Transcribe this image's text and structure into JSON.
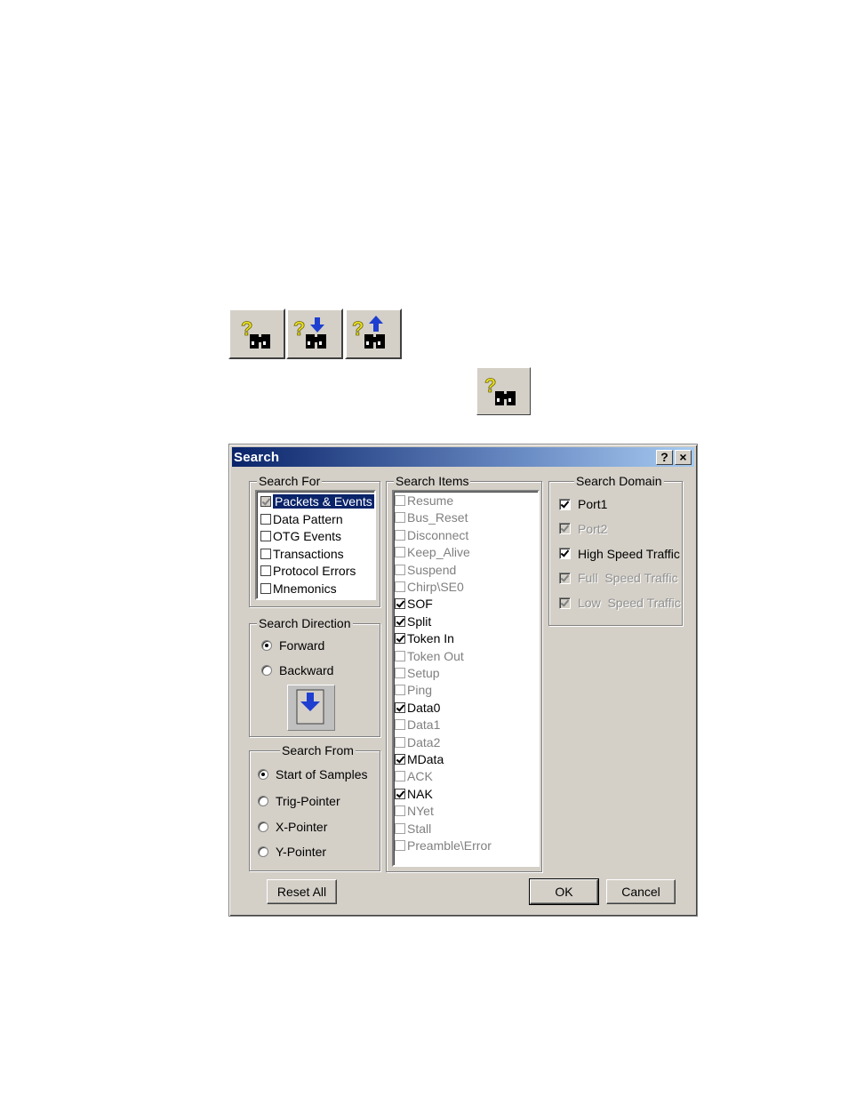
{
  "toolbar": {
    "icons": [
      "search-binoculars-icon",
      "search-next-icon",
      "search-previous-icon"
    ],
    "standalone_icon": "search-binoculars-icon"
  },
  "dialog": {
    "title": "Search",
    "help_label": "?",
    "close_label": "×",
    "search_for": {
      "legend": "Search For",
      "items": [
        {
          "label": "Packets & Events",
          "checked": true,
          "selected": true,
          "disabled": false
        },
        {
          "label": "Data Pattern",
          "checked": false,
          "selected": false,
          "disabled": false
        },
        {
          "label": "OTG Events",
          "checked": false,
          "selected": false,
          "disabled": false
        },
        {
          "label": "Transactions",
          "checked": false,
          "selected": false,
          "disabled": false
        },
        {
          "label": "Protocol Errors",
          "checked": false,
          "selected": false,
          "disabled": false
        },
        {
          "label": "Mnemonics",
          "checked": false,
          "selected": false,
          "disabled": false
        }
      ]
    },
    "search_direction": {
      "legend": "Search Direction",
      "forward": "Forward",
      "backward": "Backward",
      "selected": "forward"
    },
    "search_from": {
      "legend": "Search From",
      "options": [
        "Start of Samples",
        "Trig-Pointer",
        "X-Pointer",
        "Y-Pointer"
      ],
      "selected_index": 0
    },
    "search_items": {
      "legend": "Search Items",
      "items": [
        {
          "label": "Resume",
          "checked": false,
          "disabled": true
        },
        {
          "label": "Bus_Reset",
          "checked": false,
          "disabled": true
        },
        {
          "label": "Disconnect",
          "checked": false,
          "disabled": true
        },
        {
          "label": "Keep_Alive",
          "checked": false,
          "disabled": true
        },
        {
          "label": "Suspend",
          "checked": false,
          "disabled": true
        },
        {
          "label": "Chirp\\SE0",
          "checked": false,
          "disabled": true
        },
        {
          "label": "SOF",
          "checked": true,
          "disabled": false
        },
        {
          "label": "Split",
          "checked": true,
          "disabled": false
        },
        {
          "label": "Token In",
          "checked": true,
          "disabled": false
        },
        {
          "label": "Token Out",
          "checked": false,
          "disabled": true
        },
        {
          "label": "Setup",
          "checked": false,
          "disabled": true
        },
        {
          "label": "Ping",
          "checked": false,
          "disabled": true
        },
        {
          "label": "Data0",
          "checked": true,
          "disabled": false
        },
        {
          "label": "Data1",
          "checked": false,
          "disabled": true
        },
        {
          "label": "Data2",
          "checked": false,
          "disabled": true
        },
        {
          "label": "MData",
          "checked": true,
          "disabled": false
        },
        {
          "label": "ACK",
          "checked": false,
          "disabled": true
        },
        {
          "label": "NAK",
          "checked": true,
          "disabled": false
        },
        {
          "label": "NYet",
          "checked": false,
          "disabled": true
        },
        {
          "label": "Stall",
          "checked": false,
          "disabled": true
        },
        {
          "label": "Preamble\\Error",
          "checked": false,
          "disabled": true
        }
      ]
    },
    "search_domain": {
      "legend": "Search Domain",
      "items": [
        {
          "label": "Port1",
          "checked": true,
          "disabled": false
        },
        {
          "label": "Port2",
          "checked": true,
          "disabled": true
        },
        {
          "label": "High Speed Traffic",
          "checked": true,
          "disabled": false
        },
        {
          "label": "Full  Speed Traffic",
          "checked": true,
          "disabled": true
        },
        {
          "label": "Low  Speed Traffic",
          "checked": true,
          "disabled": true
        }
      ]
    },
    "buttons": {
      "reset_all": "Reset All",
      "ok": "OK",
      "cancel": "Cancel"
    },
    "colors": {
      "face": "#d4d0c8",
      "title_start": "#0a246a",
      "title_end": "#a6caf0",
      "selection": "#0a246a",
      "arrow": "#1f3fd0"
    }
  }
}
